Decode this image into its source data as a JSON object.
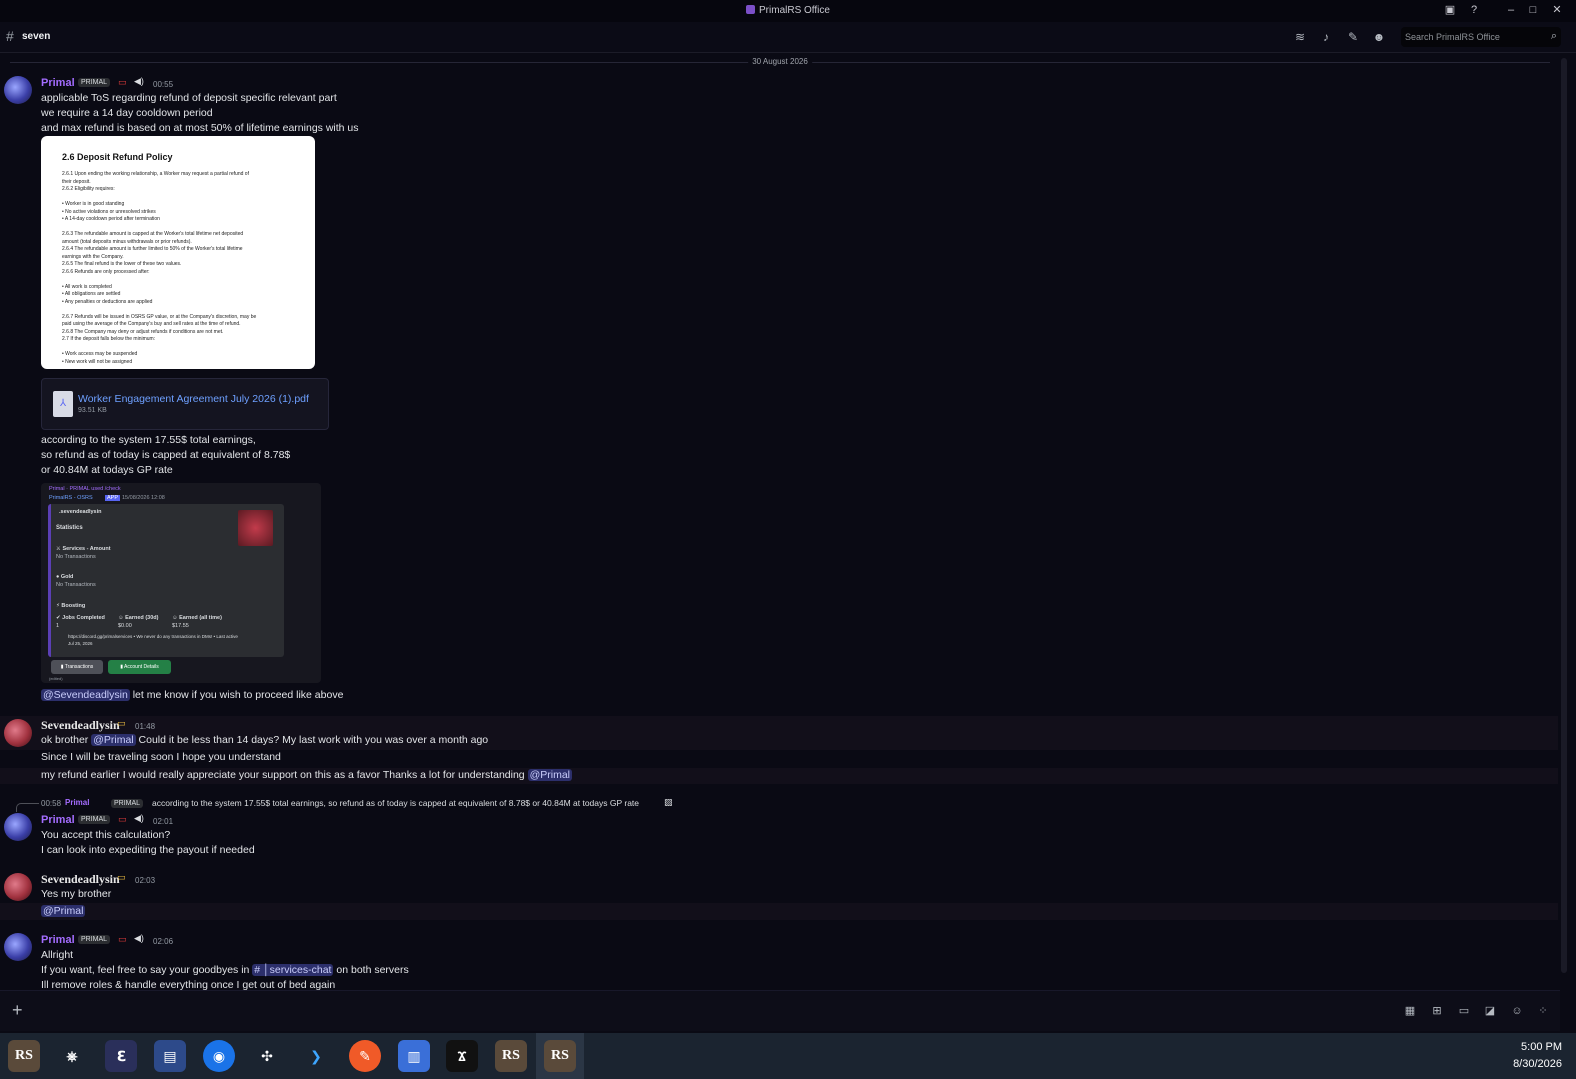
{
  "window": {
    "title": "PrimalRS Office"
  },
  "header": {
    "channel": "seven",
    "search_placeholder": "Search PrimalRS Office"
  },
  "date_separator": "30 August 2026",
  "authors": {
    "primal": "Primal",
    "seven": "Sevendeadlysin"
  },
  "primal_tag": "PRIMAL",
  "messages": {
    "m1": {
      "time": "00:55",
      "lines": [
        "applicable ToS regarding refund of deposit specific relevant part",
        "we require a 14 day cooldown period",
        "and max refund is based on at most 50% of lifetime earnings with us"
      ]
    },
    "doc": {
      "title": "2.6 Deposit Refund Policy",
      "lines": [
        "2.6.1 Upon ending the working relationship, a Worker may request a partial refund of",
        "their deposit.",
        "2.6.2 Eligibility requires:",
        "",
        "      •    Worker is in good standing",
        "      •    No active violations or unresolved strikes",
        "      •    A 14-day cooldown period after termination",
        "",
        "2.6.3 The refundable amount is capped at the Worker's total lifetime net deposited",
        "amount (total deposits minus withdrawals or prior refunds).",
        "2.6.4 The refundable amount is further limited to 50% of the Worker's total lifetime",
        "earnings with the Company.",
        "2.6.5 The final refund is the lower of these two values.",
        "2.6.6 Refunds are only processed after:",
        "",
        "      •    All work is completed",
        "      •    All obligations are settled",
        "      •    Any penalties or deductions are applied",
        "",
        "2.6.7 Refunds will be issued in OSRS GP value, or at the Company's discretion, may be",
        "paid using the average of the Company's buy and sell rates at the time of refund.",
        "2.6.8 The Company may deny or adjust refunds if conditions are not met.",
        "2.7 If the deposit falls below the minimum:",
        "",
        "      •    Work access may be suspended",
        "      •    New work will not be assigned"
      ]
    },
    "attachment": {
      "name": "Worker Engagement Agreement July 2026 (1).pdf",
      "size": "93.51 KB"
    },
    "m2_lines": [
      "according to the system 17.55$ total earnings,",
      "so refund as of today is capped at equivalent of 8.78$",
      "or 40.84M at todays GP rate"
    ],
    "embed": {
      "header": "Primal · PRIMAL used /check",
      "bot": "PrimalRS - OSRS",
      "bot_badge": "APP",
      "bot_time": "15/08/2026 12:08",
      "user": ".sevendeadlysin",
      "stats": "Statistics",
      "services": "⚔ Services - Amount",
      "no_tx1": "No Transactions",
      "gold": "● Gold",
      "no_tx2": "No Transactions",
      "boosting": "⚡ Boosting",
      "jobs": "✔ Jobs Completed",
      "jobs_val": "1",
      "earned30": "☺ Earned (30d)",
      "earned30_val": "$0.00",
      "earned_all": "☺ Earned (all time)",
      "earned_all_val": "$17.55",
      "footer": "https://discord.gg/primalservices • We never do any transactions in DMs! • Last active",
      "footer2": "Jul 25, 2026",
      "btn_tx": "▮ Transactions",
      "btn_acct": "▮ Account Details",
      "edited": "(edited)"
    },
    "m3": {
      "mention": "@Sevendeadlysin",
      "text": " let me know if you wish to proceed like above"
    },
    "s1": {
      "time": "01:48",
      "l1_pre": "ok brother ",
      "l1_mention": "@Primal",
      "l1_post": " Could it be less than 14 days? My last work with you was over a month ago",
      "l2": "Since I will be traveling soon I hope you understand",
      "l3_pre": "my refund earlier I would really appreciate your support on this as a favor Thanks a lot for understanding ",
      "l3_mention": "@Primal"
    },
    "reply": {
      "time": "00:58",
      "author": "Primal",
      "text": "according to the system 17.55$ total earnings,  so refund as of today is capped at equivalent of 8.78$ or 40.84M at todays GP rate"
    },
    "p2": {
      "time": "02:01",
      "l1": "You accept this calculation?",
      "l2": "I can look into expediting the payout if needed"
    },
    "s2": {
      "time": "02:03",
      "l1": "Yes my brother",
      "mention": "@Primal"
    },
    "p3": {
      "time": "02:06",
      "l1": "Allright",
      "l2_pre": "If you want, feel free to say your goodbyes in ",
      "l2_channel": "# │services-chat",
      "l2_post": " on both servers",
      "l3": "Ill remove roles & handle everything once I get out of bed again"
    }
  },
  "taskbar": {
    "rs_label": "RS",
    "time": "5:00 PM",
    "date": "8/30/2026"
  },
  "colors": {
    "accent": "#5865f2",
    "primal": "#a46dff",
    "background": "#0a0a14"
  }
}
